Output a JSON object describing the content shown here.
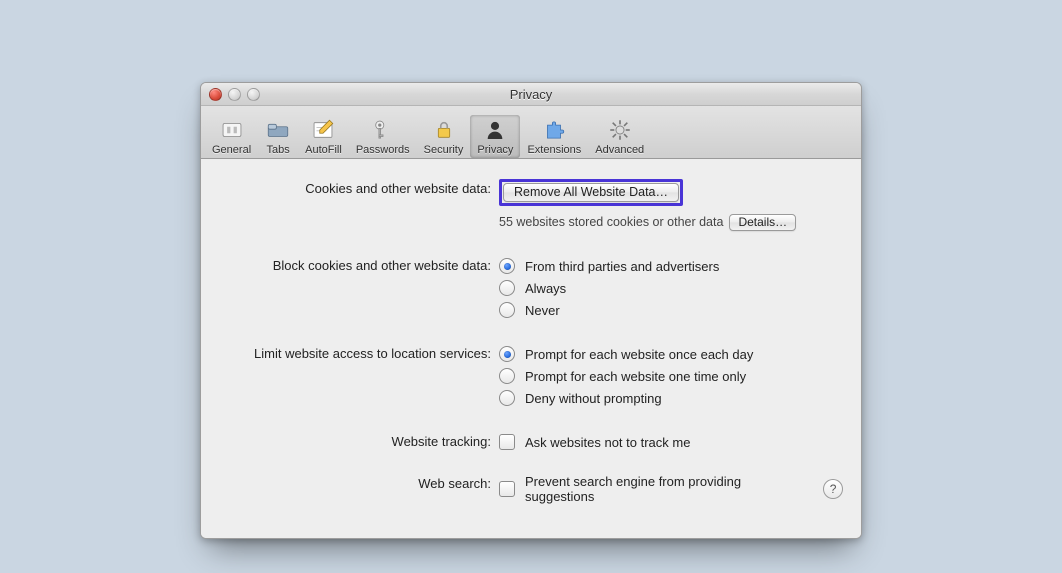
{
  "window": {
    "title": "Privacy"
  },
  "toolbar": {
    "items": [
      {
        "label": "General"
      },
      {
        "label": "Tabs"
      },
      {
        "label": "AutoFill"
      },
      {
        "label": "Passwords"
      },
      {
        "label": "Security"
      },
      {
        "label": "Privacy"
      },
      {
        "label": "Extensions"
      },
      {
        "label": "Advanced"
      }
    ]
  },
  "sections": {
    "cookies": {
      "label": "Cookies and other website data:",
      "remove_button": "Remove All Website Data…",
      "status": "55 websites stored cookies or other data",
      "details_button": "Details…"
    },
    "block": {
      "label": "Block cookies and other website data:",
      "options": [
        "From third parties and advertisers",
        "Always",
        "Never"
      ],
      "selected_index": 0
    },
    "location": {
      "label": "Limit website access to location services:",
      "options": [
        "Prompt for each website once each day",
        "Prompt for each website one time only",
        "Deny without prompting"
      ],
      "selected_index": 0
    },
    "tracking": {
      "label": "Website tracking:",
      "checkbox": "Ask websites not to track me",
      "checked": false
    },
    "websearch": {
      "label": "Web search:",
      "checkbox": "Prevent search engine from providing suggestions",
      "checked": false
    }
  },
  "help_glyph": "?"
}
